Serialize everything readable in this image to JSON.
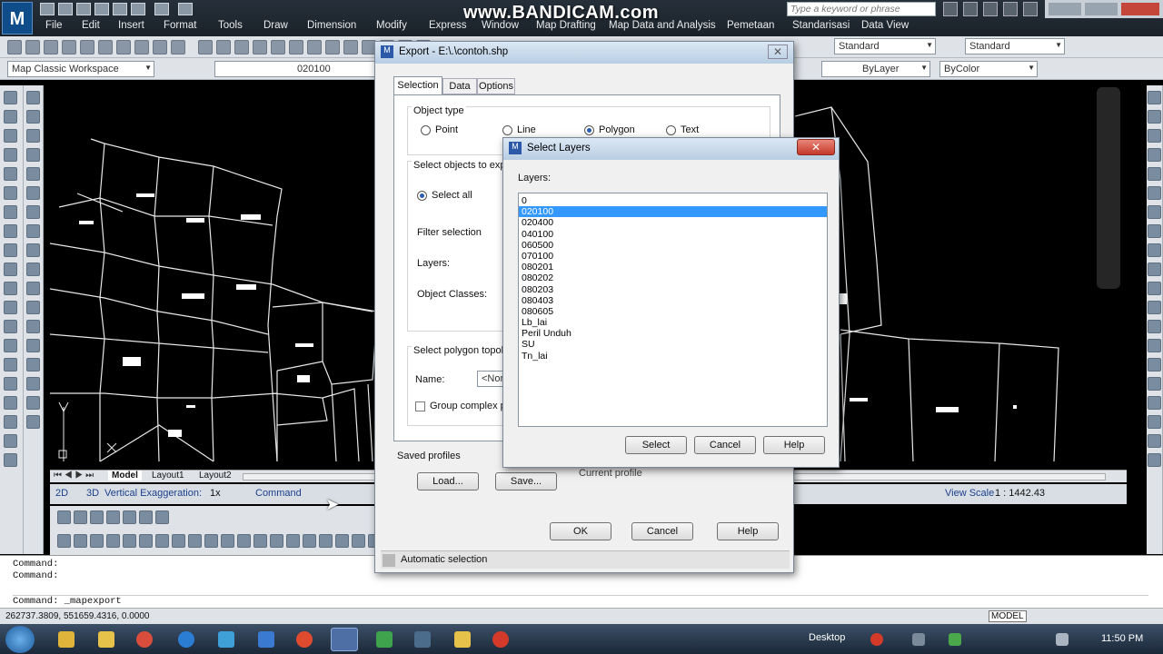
{
  "app": {
    "menu": [
      "File",
      "Edit",
      "Insert",
      "Format",
      "Tools",
      "Draw",
      "Dimension",
      "Modify",
      "Express",
      "Window",
      "Map Drafting",
      "Map Data and Analysis",
      "Pemetaan",
      "Standarisasi",
      "Data View"
    ],
    "search_placeholder": "Type a keyword or phrase",
    "watermark": "www.BANDICAM.com"
  },
  "toolbar": {
    "text_style": "Standard",
    "dim_style": "Standard",
    "workspace": "Map Classic Workspace",
    "layer_value": "020100",
    "linetype": "ByLayer",
    "color": "ByColor"
  },
  "layout_tabs": [
    "Model",
    "Layout1",
    "Layout2"
  ],
  "status": {
    "view_2d": "2D",
    "view_3d": "3D",
    "vertical_exaggeration": "Vertical Exaggeration:",
    "vex_value": "1x",
    "command_label": "Command",
    "view_scale_label": "View Scale",
    "view_scale_value": "1 : 1442.43"
  },
  "command_lines": [
    "Command:",
    "Command:",
    "Command:  _mapexport"
  ],
  "coordinates": "262737.3809, 551659.4316, 0.0000",
  "model_label": "MODEL",
  "taskbar": {
    "desktop": "Desktop",
    "time": "11:50 PM"
  },
  "export_dialog": {
    "title": "Export - E:\\.\\contoh.shp",
    "tabs": [
      "Selection",
      "Data",
      "Options"
    ],
    "object_type_label": "Object type",
    "object_types": [
      {
        "label": "Point",
        "checked": false
      },
      {
        "label": "Line",
        "checked": false
      },
      {
        "label": "Polygon",
        "checked": true
      },
      {
        "label": "Text",
        "checked": false
      }
    ],
    "select_objects_label": "Select objects to expor",
    "select_all": "Select all",
    "filter_selection": "Filter selection",
    "layers_label": "Layers:",
    "object_classes_label": "Object Classes:",
    "select_polygon_label": "Select polygon topolog",
    "name_label": "Name:",
    "name_value": "<Non",
    "group_complex": "Group complex po",
    "saved_profiles": "Saved profiles",
    "current_profile": "Current profile",
    "load": "Load...",
    "save": "Save...",
    "ok": "OK",
    "cancel": "Cancel",
    "help": "Help",
    "automatic_selection": "Automatic selection"
  },
  "select_layers_dialog": {
    "title": "Select Layers",
    "layers_label": "Layers:",
    "items": [
      "0",
      "020100",
      "020400",
      "040100",
      "060500",
      "070100",
      "080201",
      "080202",
      "080203",
      "080403",
      "080605",
      "Lb_lai",
      "Peril Unduh",
      "SU",
      "Tn_lai"
    ],
    "selected": "020100",
    "select": "Select",
    "cancel": "Cancel",
    "help": "Help"
  }
}
